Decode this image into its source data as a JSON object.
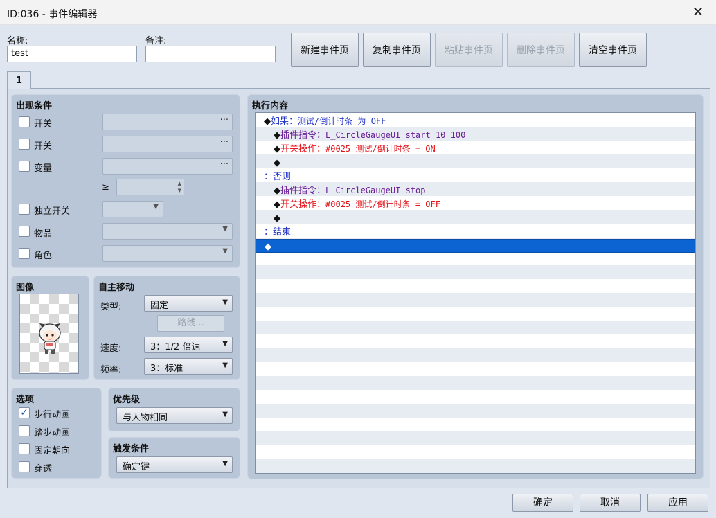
{
  "window": {
    "title": "ID:036 - 事件编辑器",
    "close_glyph": "✕"
  },
  "header": {
    "name_label": "名称:",
    "name_value": "test",
    "note_label": "备注:",
    "note_value": "",
    "buttons": {
      "new_page": "新建事件页",
      "copy_page": "复制事件页",
      "paste_page": "粘贴事件页",
      "delete_page": "删除事件页",
      "clear_page": "清空事件页"
    }
  },
  "tabs": [
    {
      "label": "1",
      "selected": true
    }
  ],
  "conditions": {
    "title": "出现条件",
    "switch1": "开关",
    "switch2": "开关",
    "variable": "变量",
    "ge_symbol": "≥",
    "self_switch": "独立开关",
    "item": "物品",
    "actor": "角色",
    "dots": "···"
  },
  "image": {
    "title": "图像"
  },
  "autonomous_movement": {
    "title": "自主移动",
    "type_label": "类型:",
    "type_value": "固定",
    "route_button": "路线...",
    "speed_label": "速度:",
    "speed_value": "3：1/2 倍速",
    "freq_label": "频率:",
    "freq_value": "3：标准"
  },
  "options": {
    "title": "选项",
    "walking": {
      "label": "步行动画",
      "checked": true
    },
    "stepping": {
      "label": "踏步动画",
      "checked": false
    },
    "direction_fix": {
      "label": "固定朝向",
      "checked": false
    },
    "through": {
      "label": "穿透",
      "checked": false
    }
  },
  "priority": {
    "title": "优先级",
    "value": "与人物相同"
  },
  "trigger": {
    "title": "触发条件",
    "value": "确定键"
  },
  "contents": {
    "title": "执行内容",
    "commands": [
      {
        "prefix": "◆",
        "label": "如果：",
        "text": "测试/倒计时条 为 OFF",
        "color": "#2235c7"
      },
      {
        "prefix": "◆",
        "label": "插件指令：",
        "text": "L_CircleGaugeUI start 10 100",
        "color": "#6a1c96"
      },
      {
        "prefix": "◆",
        "label": "开关操作：",
        "text": "#0025 测试/倒计时条 = ON",
        "color": "#e5131a"
      },
      {
        "prefix": "◆",
        "label": "",
        "text": "",
        "color": "#111111"
      },
      {
        "prefix": "：",
        "label": "否则",
        "text": "",
        "color": "#2235c7"
      },
      {
        "prefix": "◆",
        "label": "插件指令：",
        "text": "L_CircleGaugeUI stop",
        "color": "#6a1c96"
      },
      {
        "prefix": "◆",
        "label": "开关操作：",
        "text": "#0025 测试/倒计时条 = OFF",
        "color": "#e5131a"
      },
      {
        "prefix": "◆",
        "label": "",
        "text": "",
        "color": "#111111"
      },
      {
        "prefix": "：",
        "label": "结束",
        "text": "",
        "color": "#2235c7"
      },
      {
        "prefix": "◆",
        "label": "",
        "text": "",
        "color": "#ffffff",
        "selected": true
      }
    ]
  },
  "footer": {
    "ok": "确定",
    "cancel": "取消",
    "apply": "应用"
  },
  "icons": {
    "checkbox_checked": "✓",
    "dropdown_arrow": "▼",
    "spin_up": "▲",
    "spin_down": "▼"
  }
}
